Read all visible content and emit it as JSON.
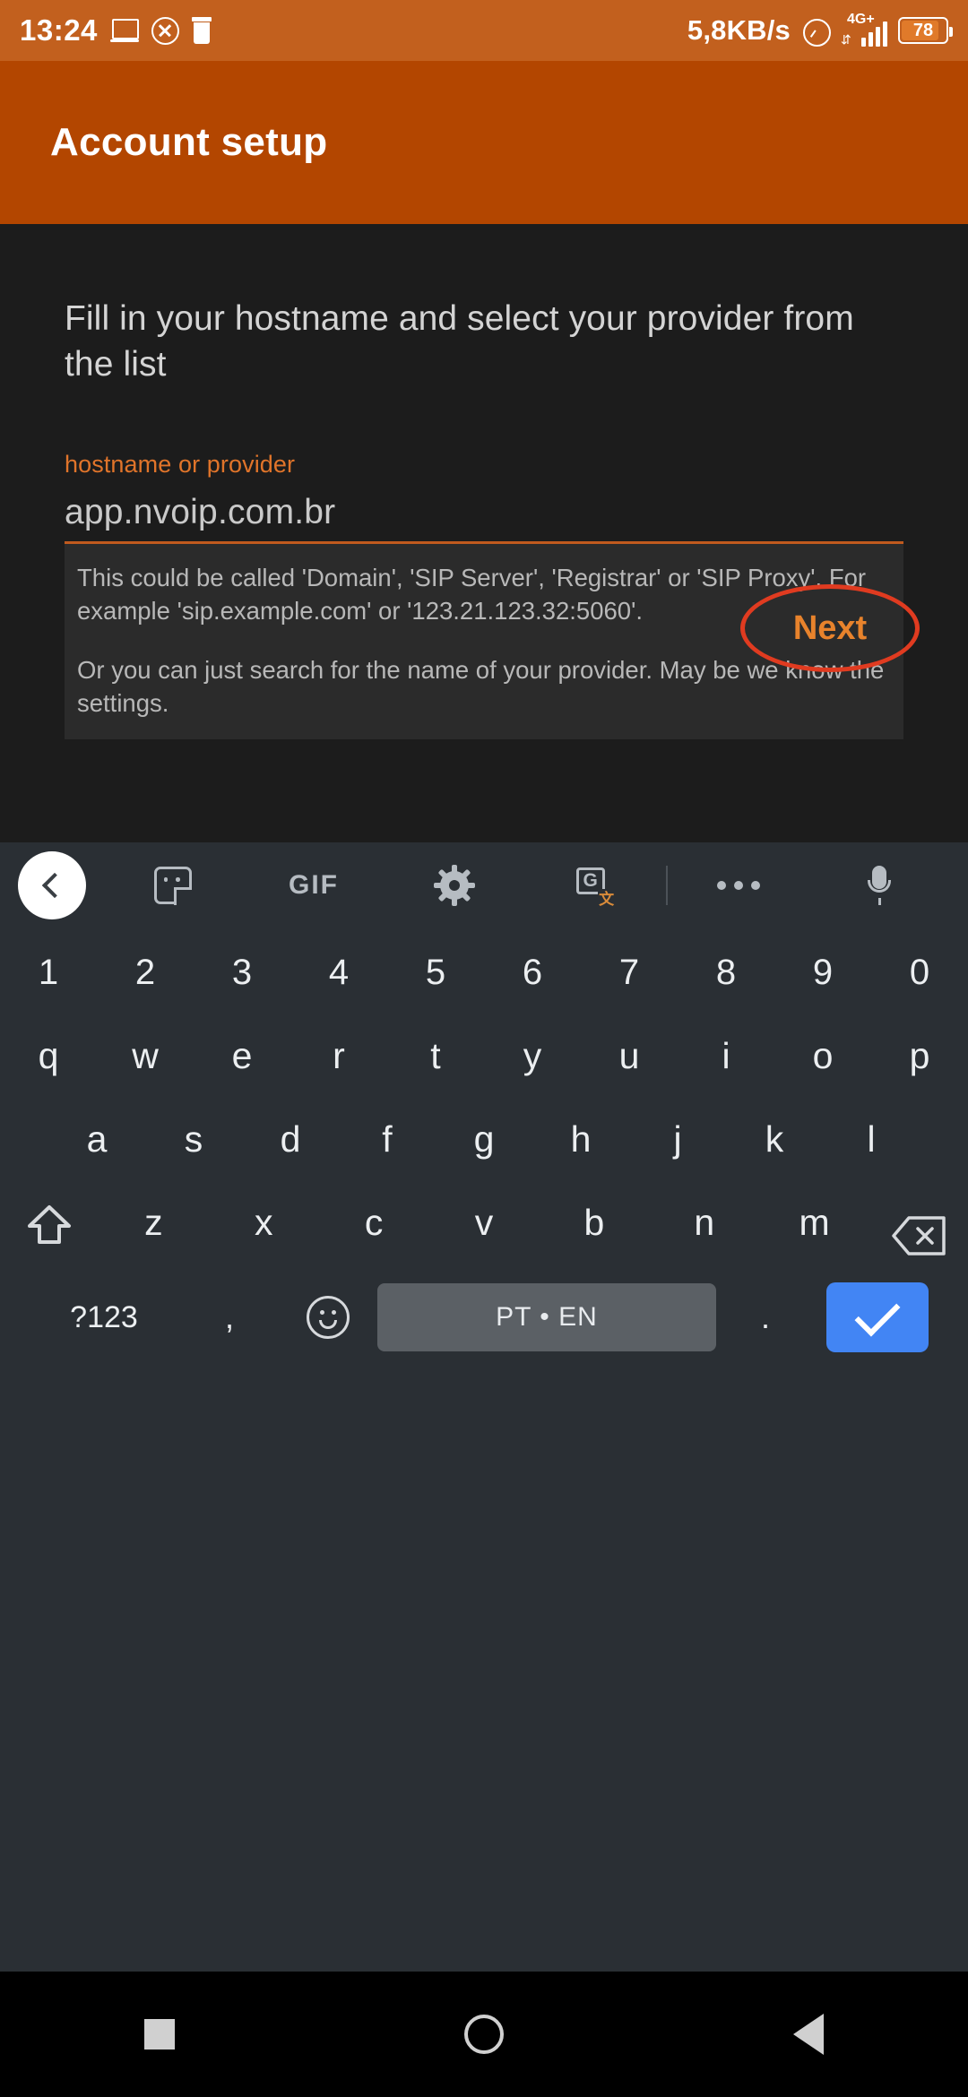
{
  "status_bar": {
    "time": "13:24",
    "icons_left": [
      "laptop-cast-icon",
      "x-circle-icon",
      "trash-icon"
    ],
    "network_speed": "5,8KB/s",
    "alarm_icon": "alarm-clock-icon",
    "network_type": "4G+",
    "battery_level": "78",
    "background_color": "#c2601e"
  },
  "app_bar": {
    "title": "Account setup",
    "background_color": "#b34600"
  },
  "content": {
    "instruction": "Fill in your hostname and select your provider from the list",
    "field": {
      "label": "hostname or provider",
      "value": "app.nvoip.com.br",
      "label_color": "#e0742a",
      "underline_color": "#c05a1e"
    },
    "helper": {
      "paragraph1": "This could be called 'Domain', 'SIP Server', 'Registrar' or 'SIP Proxy'. For example 'sip.example.com' or '123.21.123.32:5060'.",
      "paragraph2": "Or you can just search for the name of your provider. May be we know the settings."
    },
    "next_button": {
      "label": "Next",
      "text_color": "#e8832c",
      "annotation_color": "#e03b20"
    },
    "background_color": "#1c1c1c"
  },
  "keyboard": {
    "toolbar": [
      {
        "name": "back-arrow",
        "icon": "chevron-left-icon"
      },
      {
        "name": "stickers",
        "icon": "sticker-icon"
      },
      {
        "name": "gif",
        "icon": "gif-icon",
        "label": "GIF"
      },
      {
        "name": "settings",
        "icon": "gear-icon"
      },
      {
        "name": "translate",
        "icon": "translate-icon",
        "label": "G"
      },
      {
        "name": "more",
        "icon": "more-dots-icon"
      },
      {
        "name": "voice-input",
        "icon": "microphone-icon"
      }
    ],
    "row_numbers": [
      "1",
      "2",
      "3",
      "4",
      "5",
      "6",
      "7",
      "8",
      "9",
      "0"
    ],
    "row_top": [
      "q",
      "w",
      "e",
      "r",
      "t",
      "y",
      "u",
      "i",
      "o",
      "p"
    ],
    "row_home": [
      "a",
      "s",
      "d",
      "f",
      "g",
      "h",
      "j",
      "k",
      "l"
    ],
    "row_bottom": [
      "z",
      "x",
      "c",
      "v",
      "b",
      "n",
      "m"
    ],
    "shift_key": "shift-icon",
    "backspace_key": "backspace-icon",
    "symbols_key": "?123",
    "comma_key": ",",
    "emoji_key": "emoji-icon",
    "space_key": "PT • EN",
    "period_key": ".",
    "enter_key": "check-icon",
    "background_color": "#2a2f34",
    "enter_color": "#4285f4"
  },
  "nav_bar": {
    "recents": "square-icon",
    "home": "circle-icon",
    "back": "triangle-back-icon"
  }
}
